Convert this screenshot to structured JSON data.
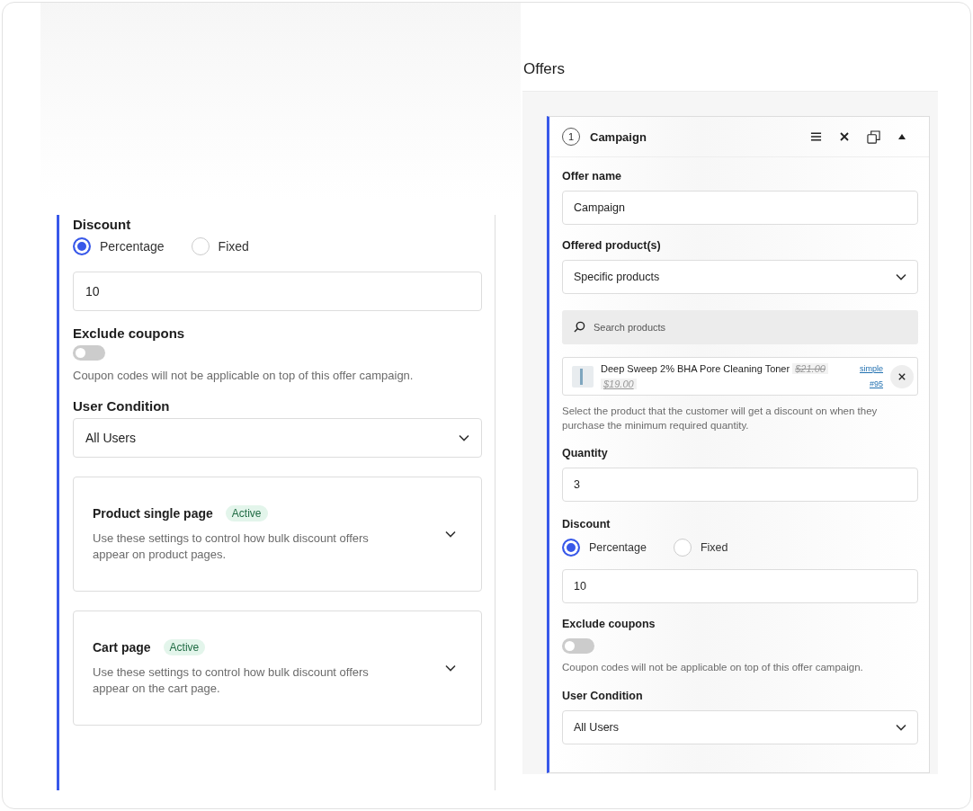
{
  "settings_panel": {
    "discount": {
      "label": "Discount",
      "options": [
        {
          "label": "Percentage",
          "selected": true
        },
        {
          "label": "Fixed",
          "selected": false
        }
      ],
      "value": "10"
    },
    "exclude_coupons": {
      "label": "Exclude coupons",
      "on": false,
      "help": "Coupon codes will not be applicable on top of this offer campaign."
    },
    "user_condition": {
      "label": "User Condition",
      "value": "All Users"
    },
    "sections": [
      {
        "title": "Product single page",
        "badge": "Active",
        "description": "Use these settings to control how bulk discount offers appear on product pages.",
        "expanded": false
      },
      {
        "title": "Cart page",
        "badge": "Active",
        "description": "Use these settings to control how bulk discount offers appear on the cart page.",
        "expanded": false
      }
    ]
  },
  "offers": {
    "title": "Offers",
    "campaign": {
      "number": "1",
      "title": "Campaign",
      "expanded": true,
      "offer_name": {
        "label": "Offer name",
        "value": "Campaign"
      },
      "offered_products": {
        "label": "Offered product(s)",
        "value": "Specific products"
      },
      "search": {
        "placeholder": "Search products"
      },
      "products": [
        {
          "name": "Deep Sweep 2% BHA Pore Cleaning Toner",
          "regular_price": "$21.00",
          "sale_price": "$19.00",
          "type_link": "simple",
          "id_link": "#95"
        }
      ],
      "products_help": "Select the product that the customer will get a discount on when they purchase the minimum required quantity.",
      "quantity": {
        "label": "Quantity",
        "value": "3"
      },
      "discount": {
        "label": "Discount",
        "options": [
          {
            "label": "Percentage",
            "selected": true
          },
          {
            "label": "Fixed",
            "selected": false
          }
        ],
        "value": "10"
      },
      "exclude_coupons": {
        "label": "Exclude coupons",
        "on": false,
        "help": "Coupon codes will not be applicable on top of this offer campaign."
      },
      "user_condition": {
        "label": "User Condition",
        "value": "All Users"
      }
    }
  }
}
